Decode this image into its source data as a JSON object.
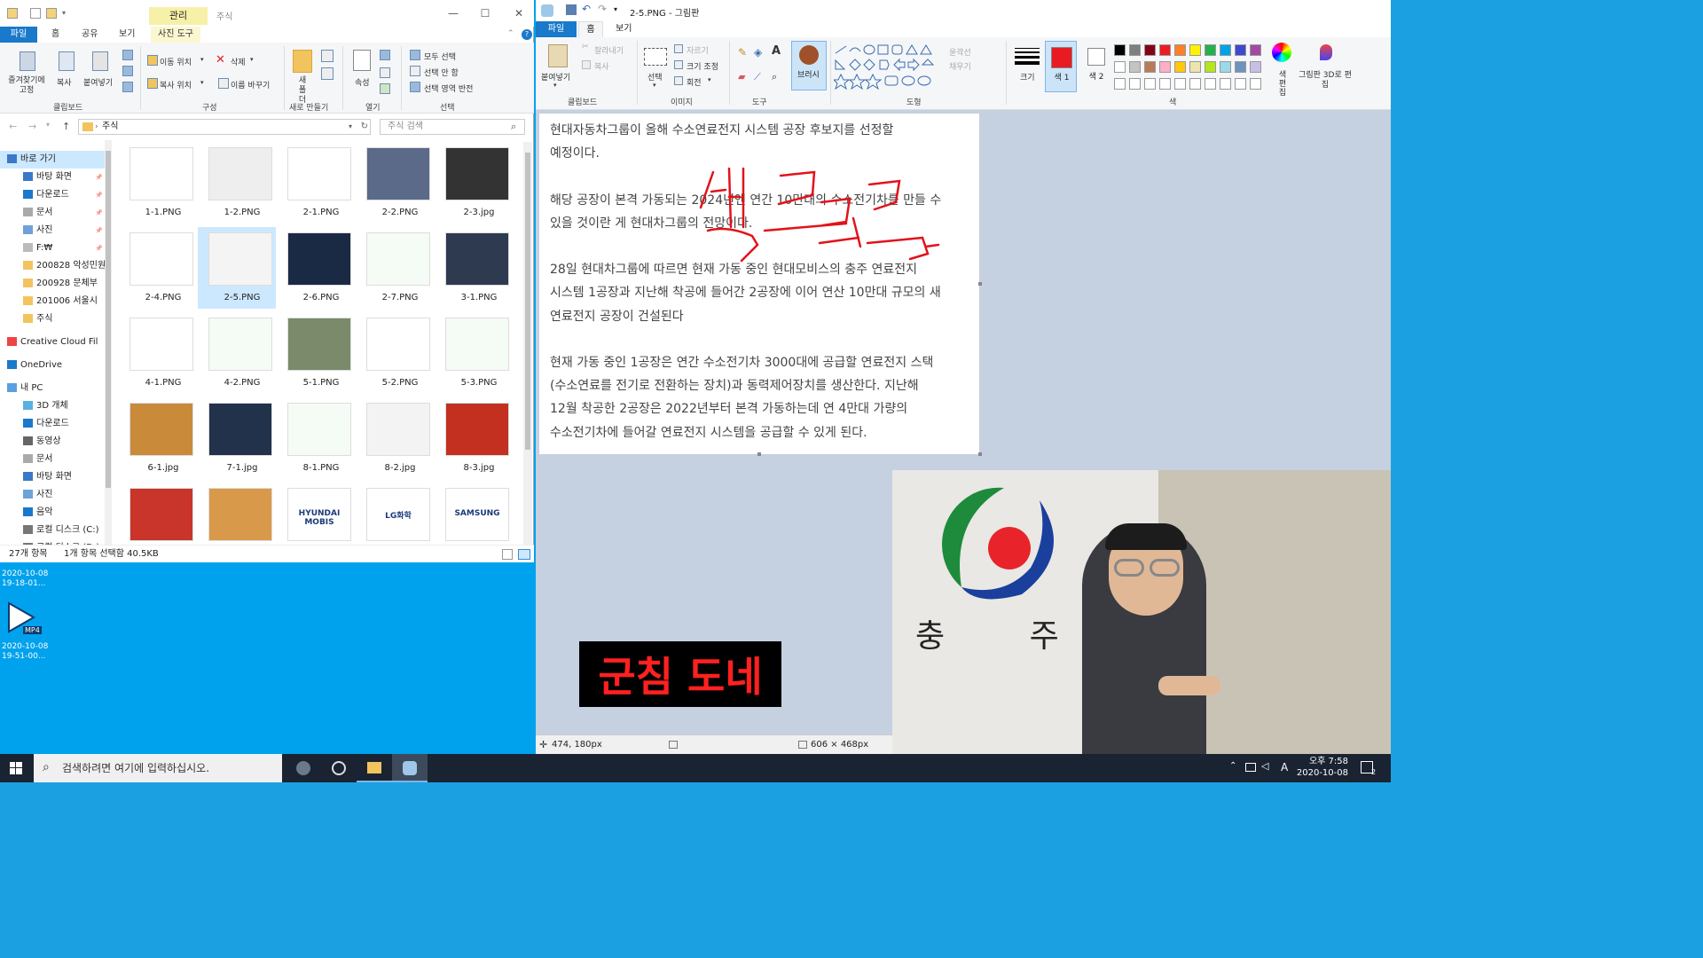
{
  "explorer": {
    "window_title_context_tab": "관리",
    "window_title_folder": "주식",
    "tabs": [
      "파일",
      "홈",
      "공유",
      "보기",
      "사진 도구"
    ],
    "ribbon": {
      "pin_label": "즐겨찾기에 고정",
      "copy_label": "복사",
      "paste_label": "붙여넣기",
      "move_to": "이동 위치",
      "copy_to": "복사 위치",
      "delete": "삭제",
      "rename": "이름 바꾸기",
      "new_folder": "새 폴더",
      "properties": "속성",
      "select_all": "모두 선택",
      "select_none": "선택 안 함",
      "invert_selection": "선택 영역 반전",
      "groups": [
        "클립보드",
        "구성",
        "새로 만들기",
        "열기",
        "선택"
      ]
    },
    "address": "주식",
    "search_placeholder": "주식 검색",
    "nav": [
      "바로 가기",
      "바탕 화면",
      "다운로드",
      "문서",
      "사진",
      "F:₩",
      "200828 악성민원",
      "200928 문체부",
      "201006 서울시",
      "주식",
      "Creative Cloud Fil",
      "OneDrive",
      "내 PC",
      "3D 개체",
      "다운로드",
      "동영상",
      "문서",
      "바탕 화면",
      "사진",
      "음악",
      "로컬 디스크 (C:)",
      "로컬 디스크 (D:)"
    ],
    "files": [
      "1-1.PNG",
      "1-2.PNG",
      "2-1.PNG",
      "2-2.PNG",
      "2-3.jpg",
      "2-4.PNG",
      "2-5.PNG",
      "2-6.PNG",
      "2-7.PNG",
      "3-1.PNG",
      "4-1.PNG",
      "4-2.PNG",
      "5-1.PNG",
      "5-2.PNG",
      "5-3.PNG",
      "6-1.jpg",
      "7-1.jpg",
      "8-1.PNG",
      "8-2.jpg",
      "8-3.jpg",
      "",
      "",
      "HYUNDAI MOBIS",
      "LG화학",
      "SAMSUNG"
    ],
    "selected_file": "2-5.PNG",
    "status_count": "27개 항목",
    "status_selected": "1개 항목 선택함 40.5KB"
  },
  "desktop": {
    "icon1_date": "2020-10-08",
    "icon1_time": "19-18-01...",
    "icon2_badge": "MP4",
    "icon2_date": "2020-10-08",
    "icon2_time": "19-51-00..."
  },
  "paint": {
    "title": "2-5.PNG - 그림판",
    "tabs": [
      "파일",
      "홈",
      "보기"
    ],
    "ribbon": {
      "paste": "붙여넣기",
      "cut": "잘라내기",
      "copy": "복사",
      "select": "선택",
      "crop": "자르기",
      "resize": "크기 조정",
      "rotate": "회전",
      "brush": "브러시",
      "outline": "윤곽선",
      "fill": "채우기",
      "size": "크기",
      "color1": "색 1",
      "color2": "색 2",
      "edit_colors": "색 편집",
      "paint3d": "그림판 3D로 편집",
      "groups": [
        "클립보드",
        "이미지",
        "도구",
        "도형",
        "색"
      ]
    },
    "canvas_text": [
      "현대자동차그룹이 올해 수소연료전지 시스템 공장 후보지를 선정할",
      "예정이다.",
      "",
      "해당 공장이 본격 가동되는 2024년엔 연간 10만대의 수소전기차를 만들 수",
      "있을 것이란 게 현대차그룹의 전망이다.",
      "",
      "28일 현대차그룹에 따르면 현재 가동 중인 현대모비스의 충주 연료전지",
      "시스템 1공장과 지난해 착공에 들어간 2공장에 이어 연산 10만대 규모의 새",
      "연료전지 공장이 건설된다",
      "",
      "현재 가동 중인 1공장은 연간 수소전기차 3000대에 공급할 연료전지 스택",
      "(수소연료를 전기로 전환하는 장치)과 동력제어장치를 생산한다. 지난해",
      "12월 착공한 2공장은 2022년부터 본격 가동하는데 연 4만대 가량의",
      "수소전기차에 들어갈 연료전지 시스템을 공급할 수 있게 된다."
    ],
    "status_cursor": "474, 180px",
    "status_size": "606 × 468px",
    "color1_value": "#e81b23",
    "palette": [
      "#000000",
      "#7f7f7f",
      "#880015",
      "#ed1c24",
      "#ff7f27",
      "#fff200",
      "#22b14c",
      "#00a2e8",
      "#3f48cc",
      "#a349a4",
      "#ffffff",
      "#c3c3c3",
      "#b97a57",
      "#ffaec9",
      "#ffc90e",
      "#efe4b0",
      "#b5e61d",
      "#99d9ea",
      "#7092be",
      "#c8bfe7"
    ]
  },
  "video": {
    "caption": "군침 도네",
    "logo_text": "충 주 시"
  },
  "taskbar": {
    "search_placeholder": "검색하려면 여기에 입력하십시오.",
    "time": "오후 7:58",
    "date": "2020-10-08",
    "ime": "A",
    "notif_count": "2"
  },
  "colors": {
    "accent": "#1979ca",
    "desktop": "#00a2ed",
    "caption_red": "#ff2020"
  }
}
